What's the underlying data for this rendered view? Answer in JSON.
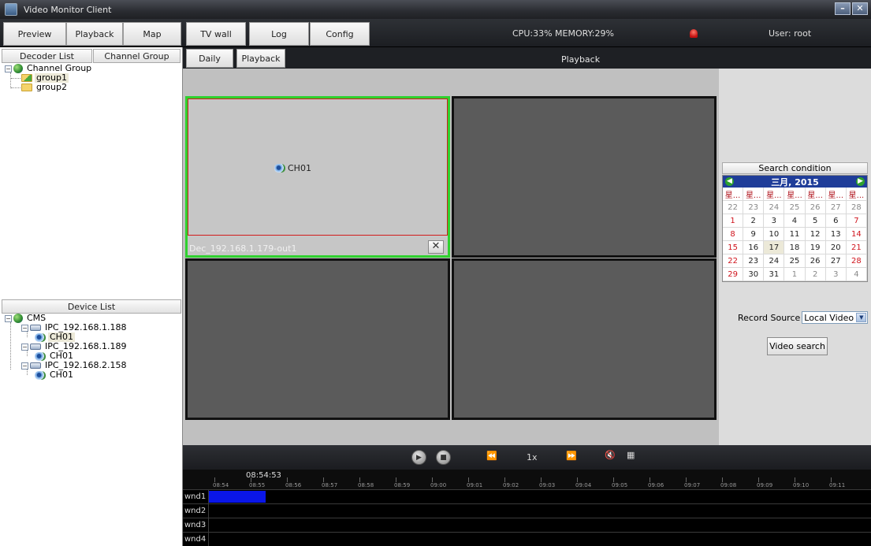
{
  "window": {
    "title": "Video Monitor Client",
    "minimize": "–",
    "close": "✕"
  },
  "nav": {
    "tabs": [
      "Preview",
      "Playback",
      "Map",
      "TV wall",
      "Log",
      "Config"
    ],
    "sysinfo": "CPU:33% MEMORY:29%",
    "user": "User: root"
  },
  "left": {
    "tabs": [
      "Decoder List",
      "Channel Group"
    ],
    "channel_tree": {
      "root": "Channel Group",
      "groups": [
        "group1",
        "group2"
      ]
    },
    "device_list_title": "Device List",
    "device_tree": {
      "root": "CMS",
      "devices": [
        {
          "name": "IPC_192.168.1.188",
          "channel": "CH01"
        },
        {
          "name": "IPC_192.168.1.189",
          "channel": "CH01"
        },
        {
          "name": "IPC_192.168.2.158",
          "channel": "CH01"
        }
      ]
    }
  },
  "subtabs": {
    "daily": "Daily",
    "playback": "Playback",
    "title": "Playback"
  },
  "video": {
    "active_channel": "CH01",
    "active_caption": "Dec_192.168.1.179-out1",
    "close_glyph": "✕"
  },
  "search": {
    "header": "Search condition",
    "calendar": {
      "title": "三月, 2015",
      "weekday_label": "星...",
      "rows": [
        [
          "22",
          "23",
          "24",
          "25",
          "26",
          "27",
          "28"
        ],
        [
          "1",
          "2",
          "3",
          "4",
          "5",
          "6",
          "7"
        ],
        [
          "8",
          "9",
          "10",
          "11",
          "12",
          "13",
          "14"
        ],
        [
          "15",
          "16",
          "17",
          "18",
          "19",
          "20",
          "21"
        ],
        [
          "22",
          "23",
          "24",
          "25",
          "26",
          "27",
          "28"
        ],
        [
          "29",
          "30",
          "31",
          "1",
          "2",
          "3",
          "4"
        ]
      ],
      "selected": "17"
    },
    "record_source_label": "Record Source",
    "record_source_value": "Local Video",
    "video_search_button": "Video search"
  },
  "controls": {
    "speed": "1x",
    "rewind": "⏪",
    "forward": "⏩"
  },
  "timeline": {
    "current_time": "08:54:53",
    "ticks": [
      "08:54",
      "08:55",
      "08:56",
      "08:57",
      "08:58",
      "08:59",
      "09:00",
      "09:01",
      "09:02",
      "09:03",
      "09:04",
      "09:05",
      "09:06",
      "09:07",
      "09:08",
      "09:09",
      "09:10",
      "09:11"
    ],
    "rows": [
      "wnd1",
      "wnd2",
      "wnd3",
      "wnd4"
    ]
  },
  "colors": {
    "active_border": "#2fd12f",
    "record_segment": "#0a16e8",
    "calendar_header": "#1f3d99"
  }
}
